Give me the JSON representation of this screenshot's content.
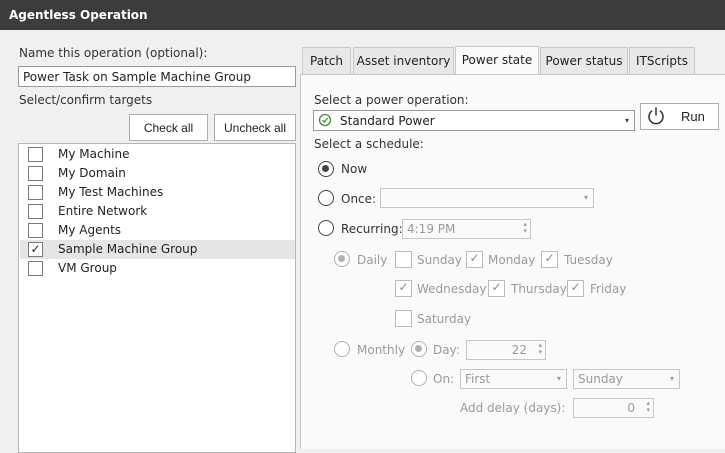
{
  "window": {
    "title": "Agentless Operation"
  },
  "left": {
    "name_label": "Name this operation (optional):",
    "name_value": "Power Task on Sample Machine Group",
    "targets_label": "Select/confirm targets",
    "check_all_label": "Check all",
    "uncheck_all_label": "Uncheck all",
    "targets": [
      {
        "label": "My Machine",
        "checked": false
      },
      {
        "label": "My Domain",
        "checked": false
      },
      {
        "label": "My Test Machines",
        "checked": false
      },
      {
        "label": "Entire Network",
        "checked": false
      },
      {
        "label": "My Agents",
        "checked": false
      },
      {
        "label": "Sample Machine Group",
        "checked": true,
        "mark": "✓"
      },
      {
        "label": "VM Group",
        "checked": false
      }
    ]
  },
  "tabs": [
    {
      "label": "Patch"
    },
    {
      "label": "Asset inventory"
    },
    {
      "label": "Power state",
      "active": true
    },
    {
      "label": "Power status"
    },
    {
      "label": "ITScripts"
    }
  ],
  "power": {
    "operation_label": "Select a power operation:",
    "operation_value": "Standard Power",
    "run_label": "Run",
    "schedule_label": "Select a schedule:",
    "now_label": "Now",
    "once_label": "Once:",
    "recurring_label": "Recurring:",
    "recurring_time": "4:19 PM",
    "daily_label": "Daily",
    "days": {
      "sunday": {
        "label": "Sunday",
        "checked": false
      },
      "monday": {
        "label": "Monday",
        "checked": true
      },
      "tuesday": {
        "label": "Tuesday",
        "checked": true
      },
      "wednesday": {
        "label": "Wednesday",
        "checked": true
      },
      "thursday": {
        "label": "Thursday",
        "checked": true
      },
      "friday": {
        "label": "Friday",
        "checked": true
      },
      "saturday": {
        "label": "Saturday",
        "checked": false
      }
    },
    "check_mark": "✓",
    "monthly_label": "Monthly",
    "day_label": "Day:",
    "day_value": "22",
    "on_label": "On:",
    "on_ordinal": "First",
    "on_weekday": "Sunday",
    "delay_label": "Add delay (days):",
    "delay_value": "0"
  }
}
